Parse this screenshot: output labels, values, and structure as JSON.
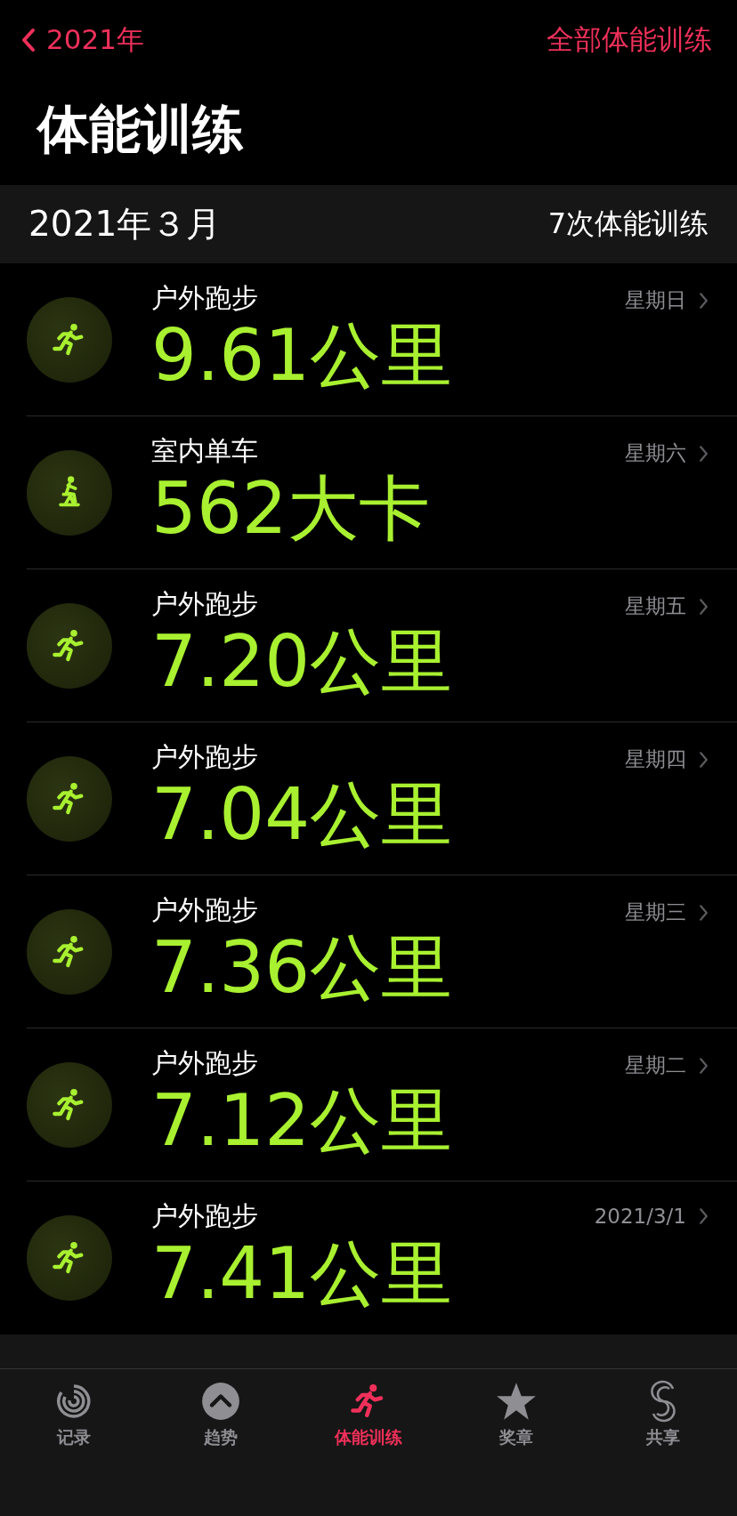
{
  "nav": {
    "back": "2021年",
    "action": "全部体能训练"
  },
  "title": "体能训练",
  "section": {
    "month": "2021年３月",
    "count": "7次体能训练"
  },
  "workouts": [
    {
      "kind": "run",
      "name": "户外跑步",
      "value": "9.61公里",
      "date": "星期日"
    },
    {
      "kind": "cycle",
      "name": "室内单车",
      "value": "562大卡",
      "date": "星期六"
    },
    {
      "kind": "run",
      "name": "户外跑步",
      "value": "7.20公里",
      "date": "星期五"
    },
    {
      "kind": "run",
      "name": "户外跑步",
      "value": "7.04公里",
      "date": "星期四"
    },
    {
      "kind": "run",
      "name": "户外跑步",
      "value": "7.36公里",
      "date": "星期三"
    },
    {
      "kind": "run",
      "name": "户外跑步",
      "value": "7.12公里",
      "date": "星期二"
    },
    {
      "kind": "run",
      "name": "户外跑步",
      "value": "7.41公里",
      "date": "2021/3/1"
    }
  ],
  "tabs": [
    {
      "kind": "rings",
      "label": "记录",
      "selected": false
    },
    {
      "kind": "trends",
      "label": "趋势",
      "selected": false
    },
    {
      "kind": "workout",
      "label": "体能训练",
      "selected": true
    },
    {
      "kind": "awards",
      "label": "奖章",
      "selected": false
    },
    {
      "kind": "sharing",
      "label": "共享",
      "selected": false
    }
  ]
}
